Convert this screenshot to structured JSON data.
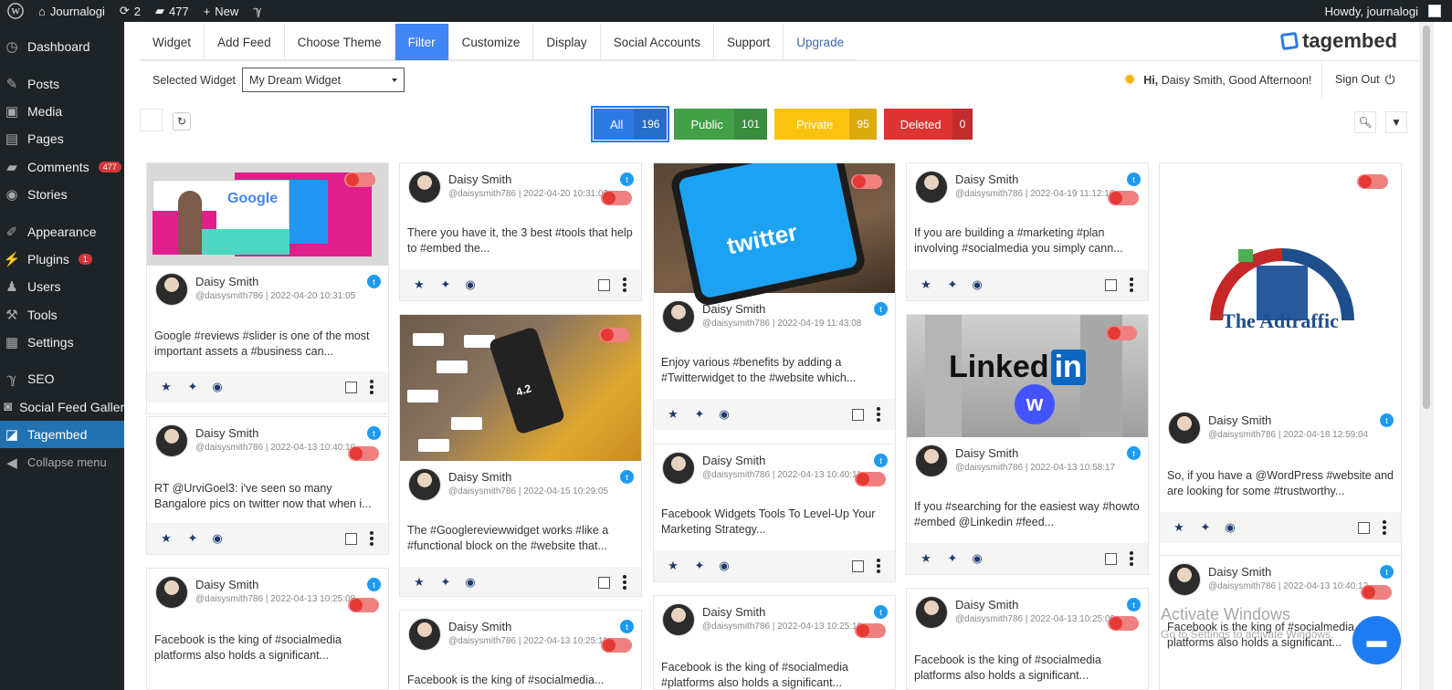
{
  "adminbar": {
    "site_name": "Journalogi",
    "updates_count": "2",
    "comments_count": "477",
    "new_label": "New",
    "greeting": "Howdy, journalogi"
  },
  "sidebar": {
    "items": [
      {
        "label": "Dashboard",
        "icon": "dashboard-icon",
        "glyph": "◷"
      },
      {
        "label": "Posts",
        "icon": "pin-icon",
        "glyph": "✎"
      },
      {
        "label": "Media",
        "icon": "media-icon",
        "glyph": "▣"
      },
      {
        "label": "Pages",
        "icon": "pages-icon",
        "glyph": "▤"
      },
      {
        "label": "Comments",
        "icon": "comment-icon",
        "glyph": "▰",
        "badge": "477"
      },
      {
        "label": "Stories",
        "icon": "stories-icon",
        "glyph": "◉"
      },
      {
        "label": "Appearance",
        "icon": "brush-icon",
        "glyph": "✐"
      },
      {
        "label": "Plugins",
        "icon": "plugin-icon",
        "glyph": "⚡",
        "badge": "1"
      },
      {
        "label": "Users",
        "icon": "users-icon",
        "glyph": "♟"
      },
      {
        "label": "Tools",
        "icon": "wrench-icon",
        "glyph": "⚒"
      },
      {
        "label": "Settings",
        "icon": "settings-icon",
        "glyph": "▦"
      },
      {
        "label": "SEO",
        "icon": "yoast-icon",
        "glyph": "ℽ"
      },
      {
        "label": "Social Feed Gallery",
        "icon": "gallery-icon",
        "glyph": "◙"
      },
      {
        "label": "Tagembed",
        "icon": "tagembed-icon",
        "glyph": "◪"
      },
      {
        "label": "Collapse menu",
        "icon": "collapse-icon",
        "glyph": "◀"
      }
    ]
  },
  "tabs": [
    "Widget",
    "Add Feed",
    "Choose Theme",
    "Filter",
    "Customize",
    "Display",
    "Social Accounts",
    "Support",
    "Upgrade"
  ],
  "active_tab": "Filter",
  "logo": "tagembed",
  "selected_widget": {
    "label": "Selected Widget",
    "value": "My Dream Widget"
  },
  "greeting": {
    "hi": "Hi,",
    "text": "Daisy Smith, Good Afternoon!"
  },
  "signout_label": "Sign Out",
  "filters": {
    "all": {
      "label": "All",
      "count": "196"
    },
    "public": {
      "label": "Public",
      "count": "101"
    },
    "private": {
      "label": "Private",
      "count": "95"
    },
    "deleted": {
      "label": "Deleted",
      "count": "0"
    }
  },
  "images": {
    "google": "Google",
    "twitter": "twitter",
    "linkedin": "Linked",
    "linkedin_in": "in",
    "webflow": "w",
    "adtraffic": "The Adtraffic",
    "review_rating": "4.2"
  },
  "author": "Daisy Smith",
  "posts": {
    "c1p1": {
      "handle": "@daisysmith786",
      "date": "2022-04-20 10:31:05",
      "text": "Google #reviews #slider is one of the most important assets a #business can..."
    },
    "c1p2": {
      "handle": "@daisysmith786",
      "date": "2022-04-13 10:40:10",
      "text": "RT @UrviGoel3: i've seen so many Bangalore pics on twitter now that when i..."
    },
    "c1p3": {
      "handle": "@daisysmith786",
      "date": "2022-04-13 10:25:08",
      "text": "Facebook is the king of #socialmedia platforms also holds a significant..."
    },
    "c2p1": {
      "handle": "@daisysmith786",
      "date": "2022-04-20 10:31:06",
      "text": "There you have it, the 3 best #tools that help to #embed the..."
    },
    "c2p2": {
      "handle": "@daisysmith786",
      "date": "2022-04-15 10:29:05",
      "text": "The #Googlereviewwidget works #like a #functional block on the #website that..."
    },
    "c2p3": {
      "handle": "@daisysmith786",
      "date": "2022-04-13 10:25:11",
      "text": "Facebook is the king of #socialmedia..."
    },
    "c3p1": {
      "handle": "@daisysmith786",
      "date": "2022-04-19 11:43:08",
      "text": "Enjoy various #benefits by adding a #Twitterwidget to the #website which..."
    },
    "c3p2": {
      "handle": "@daisysmith786",
      "date": "2022-04-13 10:40:11",
      "text": "Facebook Widgets Tools To Level-Up Your Marketing Strategy..."
    },
    "c3p3": {
      "handle": "@daisysmith786",
      "date": "2022-04-13 10:25:10",
      "text": "Facebook is the king of #socialmedia #platforms also holds a significant..."
    },
    "c4p1": {
      "handle": "@daisysmith786",
      "date": "2022-04-19 11:12:16",
      "text": "If you are building a #marketing #plan involving #socialmedia you simply cann..."
    },
    "c4p2": {
      "handle": "@daisysmith786",
      "date": "2022-04-13 10:58:17",
      "text": "If you #searching for the easiest way #howto #embed @Linkedin #feed..."
    },
    "c4p3": {
      "handle": "@daisysmith786",
      "date": "2022-04-13 10:25:09",
      "text": "Facebook is the king of #socialmedia platforms also holds a significant..."
    },
    "c5p1": {
      "handle": "@daisysmith786",
      "date": "2022-04-18 12:59:04",
      "text": "So, if you have a @WordPress #website and are looking for some #trustworthy..."
    },
    "c5p2": {
      "handle": "@daisysmith786",
      "date": "2022-04-13 10:40:12",
      "text": "Facebook is the king of #socialmedia platforms also holds a significant..."
    }
  },
  "windows_watermark": {
    "title": "Activate Windows",
    "subtitle": "Go to Settings to activate Windows."
  },
  "colors": {
    "accent": "#4285f4",
    "public": "#43a047",
    "private": "#f9c30f",
    "deleted": "#dd3333",
    "wp_active": "#2271b1",
    "twitter": "#1d9bf0"
  }
}
